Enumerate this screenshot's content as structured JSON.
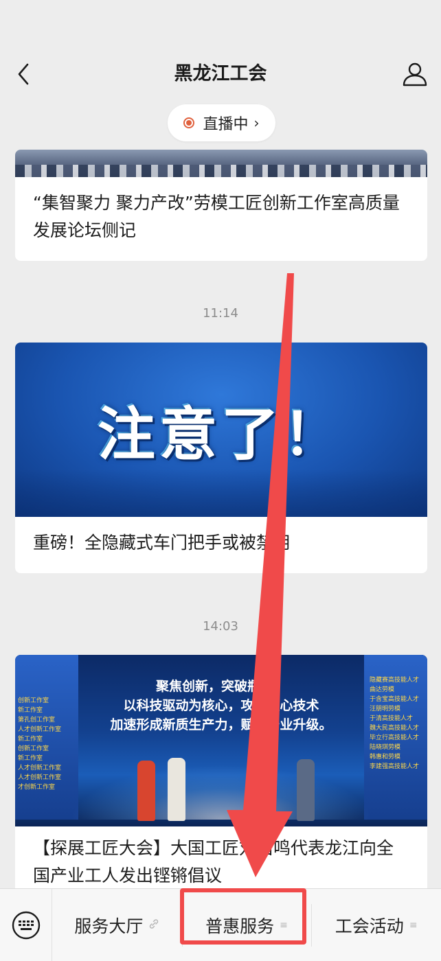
{
  "header": {
    "title": "黑龙江工会",
    "live_label": "直播中",
    "live_chevron": "›"
  },
  "feed": {
    "items": [
      {
        "title": "“集智聚力 聚力产改”劳模工匠创新工作室高质量发展论坛侧记"
      },
      {
        "time": "11:14",
        "image_text": "注意了！",
        "title": "重磅！全隐藏式车门把手或被禁用"
      },
      {
        "time": "14:03",
        "image_text": {
          "line1": "聚焦创新，突破瓶颈！",
          "line2": "以科技驱动为核心，攻克核心技术",
          "line3": "加速形成新质生产力，赋能产业升级。"
        },
        "left_screen": [
          "创新工作室",
          "新工作室",
          "第孔创工作室",
          "人才创新工作室",
          "新工作室",
          "创新工作室",
          "新工作室",
          "人才创新工作室",
          "人才创新工作室",
          "才创新工作室"
        ],
        "right_screen": [
          "隐藏赛高技能人才",
          "曲达劳模",
          "于含宝高技能人才",
          "汪朋明劳模",
          "于清高技能人才",
          "魏大民高技能人才",
          "毕立行高技能人才",
          "陆晓琪劳模",
          "韩惠和劳模",
          "李建强高技能人才"
        ],
        "title": "【探展工匠大会】大国工匠刘伯鸣代表龙江向全国产业工人发出铿锵倡议"
      }
    ]
  },
  "menu": {
    "items": [
      {
        "label": "服务大厅",
        "icon": "link-icon"
      },
      {
        "label": "普惠服务",
        "icon": "menu-lines-icon"
      },
      {
        "label": "工会活动",
        "icon": "menu-lines-icon"
      }
    ]
  },
  "colors": {
    "background": "#ededed",
    "live_accent": "#e0603c",
    "annotation_red": "#f04a4a"
  }
}
